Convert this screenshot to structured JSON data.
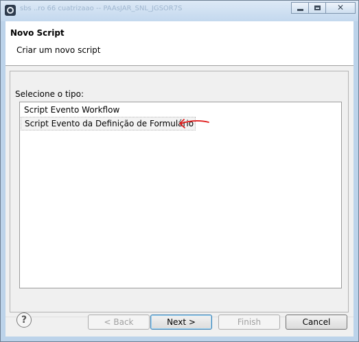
{
  "window": {
    "title": "sbs ..ro 66 cuatrizaao -- PAAsJAR_SNL_JGSOR7S",
    "controls": [
      "minimize-icon",
      "maximize-icon",
      "close-icon"
    ]
  },
  "header": {
    "title": "Novo Script",
    "description": "Criar um novo script"
  },
  "content": {
    "label": "Selecione o tipo:",
    "items": [
      {
        "label": "Script Evento Workflow"
      },
      {
        "label": "Script Evento da Definição de Formulário"
      }
    ],
    "annotation": {
      "icon": "red-arrow-icon",
      "color": "#e02020"
    }
  },
  "footer": {
    "help_icon": "question-mark-icon",
    "back_label": "< Back",
    "next_label": "Next >",
    "finish_label": "Finish",
    "cancel_label": "Cancel"
  }
}
